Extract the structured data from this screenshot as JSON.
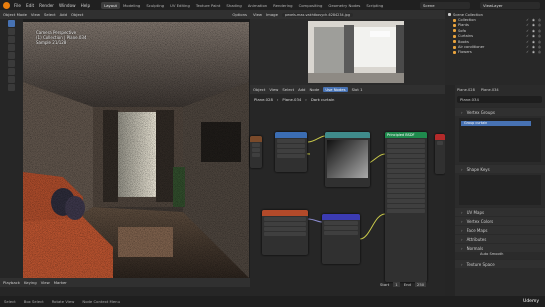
{
  "menu": [
    "File",
    "Edit",
    "Render",
    "Window",
    "Help"
  ],
  "workspaces": [
    "Layout",
    "Modeling",
    "Sculpting",
    "UV Editing",
    "Texture Paint",
    "Shading",
    "Animation",
    "Rendering",
    "Compositing",
    "Geometry Nodes",
    "Scripting"
  ],
  "active_workspace": "Layout",
  "scene": {
    "name": "Scene",
    "view_layer": "ViewLayer"
  },
  "viewport": {
    "header": [
      "Object Mode",
      "View",
      "Select",
      "Add",
      "Object"
    ],
    "options": "Options",
    "overlay": [
      "Camera Perspective",
      "(1) Collection | Plane.034",
      "Sample 21/128"
    ]
  },
  "image_editor": {
    "header": [
      "View",
      "Image"
    ],
    "image_name": "pexels-max-vakhtbovych-6284234.jpg"
  },
  "node_editor": {
    "header": [
      "Object",
      "View",
      "Select",
      "Add",
      "Node",
      "Use Nodes",
      "Slot 1"
    ],
    "breadcrumb": [
      "Plane.028",
      "Plane.034",
      "Dark curtain"
    ],
    "node_title": "Principled BSDF"
  },
  "outliner": {
    "title": "Scene Collection",
    "items": [
      {
        "name": "Collection",
        "color": "#e8a33d"
      },
      {
        "name": "Plants",
        "color": "#e8a33d"
      },
      {
        "name": "Sofa",
        "color": "#e8a33d"
      },
      {
        "name": "Curtains",
        "color": "#e8a33d"
      },
      {
        "name": "Books",
        "color": "#e8a33d"
      },
      {
        "name": "Air conditioner",
        "color": "#e8a33d"
      },
      {
        "name": "Flowers",
        "color": "#e8a33d"
      }
    ]
  },
  "properties": {
    "object_path": [
      "Plane.028",
      "Plane.034"
    ],
    "object_name": "Plane.034",
    "sections": [
      "Vertex Groups",
      "Shape Keys",
      "UV Maps",
      "Vertex Colors",
      "Face Maps",
      "Attributes",
      "Normals",
      "Texture Space"
    ],
    "vertex_group": "Group curtain",
    "auto_smooth": "Auto Smooth"
  },
  "timeline": {
    "labels": [
      "Playback",
      "Keying",
      "View",
      "Marker"
    ],
    "start_label": "Start",
    "start": "1",
    "end_label": "End",
    "end": "250",
    "current": "1"
  },
  "statusbar": [
    "Select",
    "Box Select",
    "Rotate View",
    "Node Context Menu"
  ],
  "watermark": "Udemy",
  "colors": {
    "accent": "#4772b3",
    "blender_orange": "#e87d0d",
    "node_green": "#1f8a4d",
    "node_blue": "#3b6db3",
    "node_teal": "#3f8a8a"
  }
}
